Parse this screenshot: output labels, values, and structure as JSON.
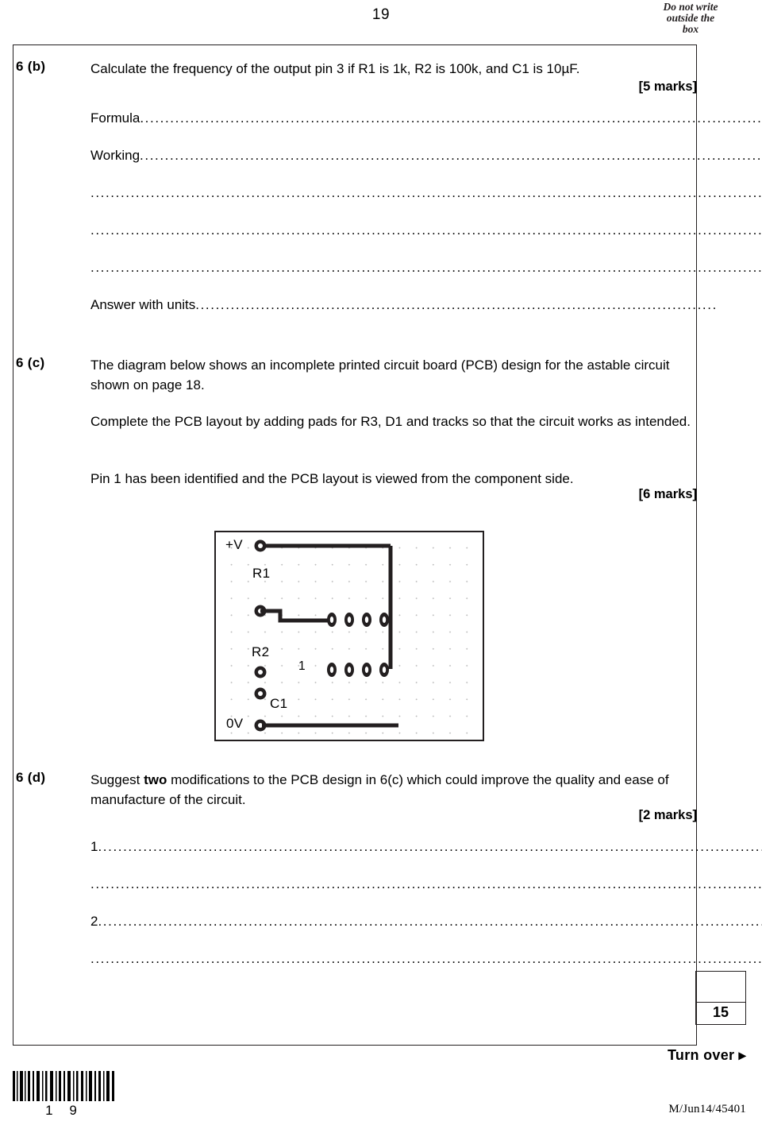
{
  "page": {
    "number": "19",
    "do_not_write": [
      "Do not write",
      "outside the",
      "box"
    ],
    "paper_code": "M/Jun14/45401",
    "barcode_digits": "1 9",
    "turn_over": "Turn over",
    "turn_over_arrow": "▸",
    "score_value": "15"
  },
  "questions": [
    {
      "label": "6 (b)",
      "text": "Calculate the frequency of the output pin 3 if R1 is 1k, R2 is 100k, and C1 is 10µF.",
      "marks": "[5 marks]",
      "answer_lines": [
        {
          "prompt": "Formula",
          "dots": "............................................................................................................................"
        },
        {
          "prompt": "Working",
          "dots": "............................................................................................................................."
        },
        {
          "prompt": "",
          "dots": "............................................................................................................................................................"
        },
        {
          "prompt": "",
          "dots": "............................................................................................................................................................"
        },
        {
          "prompt": "",
          "dots": "............................................................................................................................................................"
        },
        {
          "prompt": "Answer with units",
          "dots": "........................................................................................................"
        }
      ]
    },
    {
      "label": "6 (c)",
      "paragraphs": [
        "The diagram below shows an incomplete printed circuit board (PCB) design for the astable circuit shown on page 18.",
        "Complete the PCB layout by adding pads for R3, D1 and tracks so that the circuit works as intended.",
        "Pin 1 has been identified and the PCB layout is viewed from the component side."
      ],
      "marks": "[6 marks]"
    },
    {
      "label": "6 (d)",
      "text": "Suggest two modifications to the PCB design in 6(c) which could improve the quality and ease of manufacture of the circuit.",
      "text_bold_word": "two",
      "marks": "[2 marks]",
      "answer_lines": [
        {
          "prompt": "1",
          "dots": ".............................................................................................................................................."
        },
        {
          "prompt": "",
          "dots": "............................................................................................................................................................"
        },
        {
          "prompt": "2",
          "dots": ".............................................................................................................................................."
        },
        {
          "prompt": "",
          "dots": "............................................................................................................................................................"
        }
      ]
    }
  ],
  "pcb": {
    "labels": {
      "plus_v": "+V",
      "zero_v": "0V",
      "r1": "R1",
      "r2": "R2",
      "c1": "C1",
      "pin1": "1"
    }
  }
}
